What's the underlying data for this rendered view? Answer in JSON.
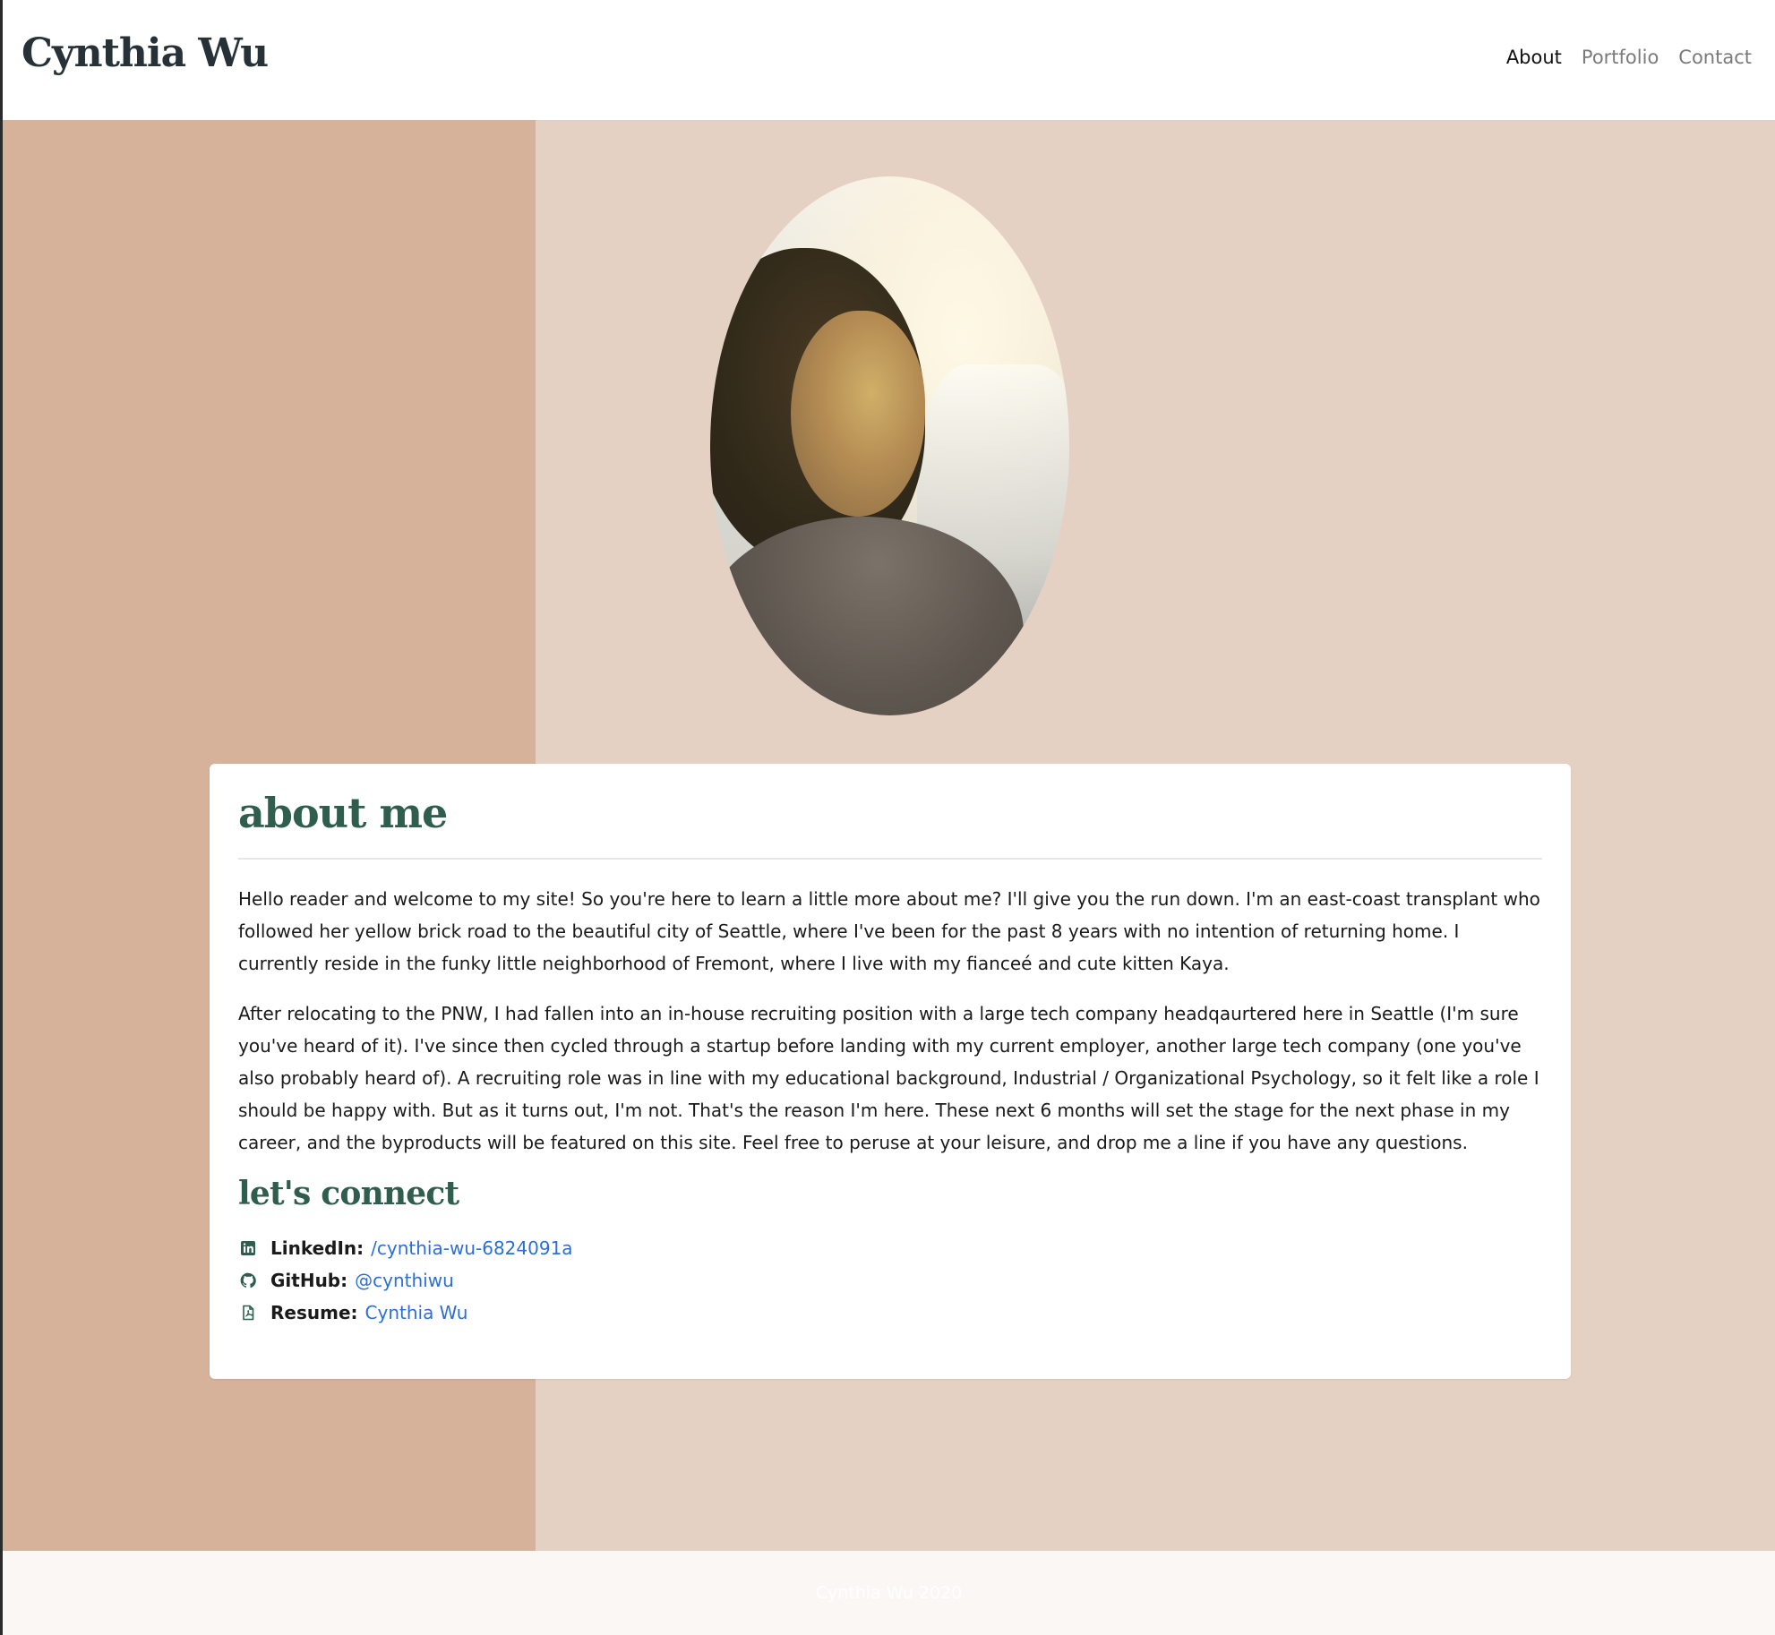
{
  "header": {
    "brand": "Cynthia Wu",
    "nav": [
      {
        "label": "About",
        "active": true
      },
      {
        "label": "Portfolio",
        "active": false
      },
      {
        "label": "Contact",
        "active": false
      }
    ]
  },
  "hero": {
    "colors": {
      "left_panel": "#d6b29a",
      "right_panel": "#e5d1c4"
    }
  },
  "card": {
    "title": "about me",
    "paragraphs": [
      "Hello reader and welcome to my site! So you're here to learn a little more about me? I'll give you the run down. I'm an east-coast transplant who followed her yellow brick road to the beautiful city of Seattle, where I've been for the past 8 years with no intention of returning home. I currently reside in the funky little neighborhood of Fremont, where I live with my fianceé and cute kitten Kaya.",
      "After relocating to the PNW, I had fallen into an in-house recruiting position with a large tech company headqaurtered here in Seattle (I'm sure you've heard of it). I've since then cycled through a startup before landing with my current employer, another large tech company (one you've also probably heard of). A recruiting role was in line with my educational background, Industrial / Organizational Psychology, so it felt like a role I should be happy with. But as it turns out, I'm not. That's the reason I'm here. These next 6 months will set the stage for the next phase in my career, and the byproducts will be featured on this site. Feel free to peruse at your leisure, and drop me a line if you have any questions."
    ],
    "connect_title": "let's connect",
    "links": [
      {
        "icon": "linkedin-icon",
        "label": "LinkedIn:",
        "value": "/cynthia-wu-6824091a"
      },
      {
        "icon": "github-icon",
        "label": "GitHub:",
        "value": "@cynthiwu"
      },
      {
        "icon": "pdf-file-icon",
        "label": "Resume:",
        "value": "Cynthia Wu"
      }
    ]
  },
  "footer": {
    "text": "Cynthia Wu 2020"
  },
  "colors": {
    "accent_green": "#2f5e4e",
    "link_blue": "#2b6fd6",
    "brand_text": "#263238"
  }
}
